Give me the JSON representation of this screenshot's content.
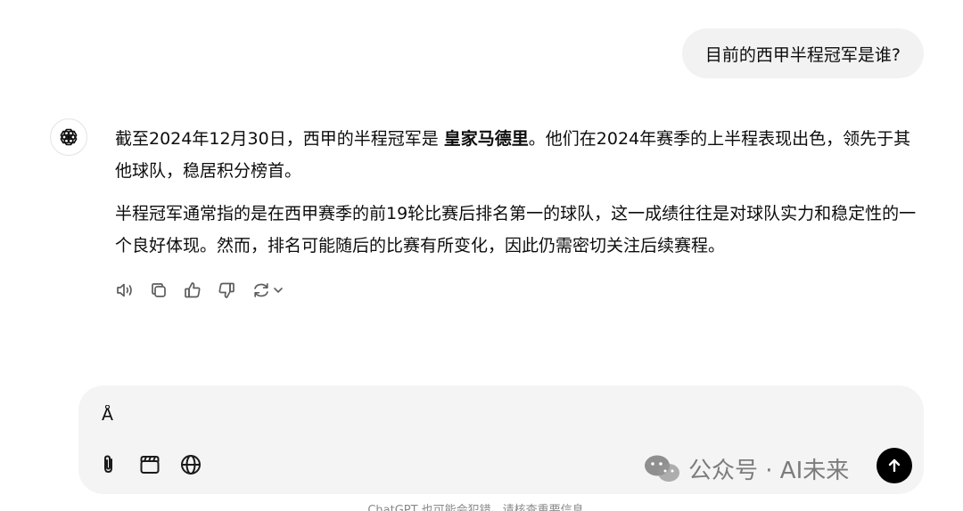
{
  "user_message": "目前的西甲半程冠军是谁?",
  "assistant": {
    "para1_prefix": "截至2024年12月30日，西甲的半程冠军是 ",
    "para1_bold": "皇家马德里",
    "para1_suffix": "。他们在2024年赛季的上半程表现出色，领先于其他球队，稳居积分榜首。",
    "para2": "半程冠军通常指的是在西甲赛季的前19轮比赛后排名第一的球队，这一成绩往往是对球队实力和稳定性的一个良好体现。然而，排名可能随后的比赛有所变化，因此仍需密切关注后续赛程。"
  },
  "actions": [
    {
      "name": "read-aloud-icon"
    },
    {
      "name": "copy-icon"
    },
    {
      "name": "thumbs-up-icon"
    },
    {
      "name": "thumbs-down-icon"
    },
    {
      "name": "regenerate-icon"
    }
  ],
  "composer": {
    "value": "Å",
    "tools": [
      "attach-icon",
      "clapperboard-icon",
      "globe-icon"
    ]
  },
  "watermark": "公众号 · AI未来",
  "footer_note": "ChatGPT 也可能会犯错。请核查重要信息。"
}
